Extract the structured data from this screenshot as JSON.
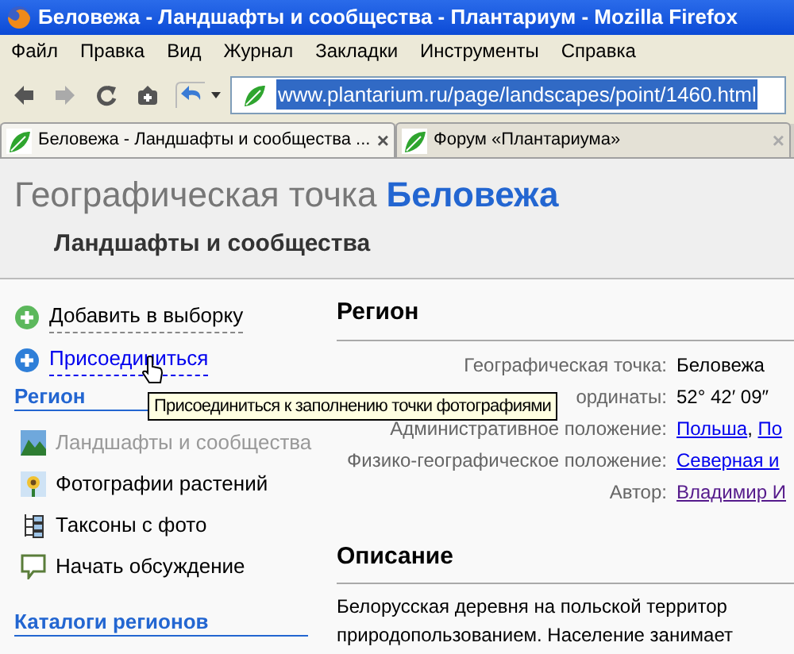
{
  "window": {
    "title": "Беловежа - Ландшафты и сообщества - Плантариум - Mozilla Firefox"
  },
  "menu": [
    "Файл",
    "Правка",
    "Вид",
    "Журнал",
    "Закладки",
    "Инструменты",
    "Справка"
  ],
  "address": {
    "value": "www.plantarium.ru/page/landscapes/point/1460.html",
    "selected": true
  },
  "tabs": [
    {
      "label": "Беловежа - Ландшафты и сообщества ...",
      "selected": true,
      "close": "×"
    },
    {
      "label": "Форум «Плантариума»",
      "selected": false,
      "close": "×"
    }
  ],
  "header": {
    "title": "Географическая точка",
    "name": "Беловежа",
    "subtitle": "Ландшафты и сообщества"
  },
  "actions": [
    {
      "label": "Добавить в выборку",
      "kind": "add"
    },
    {
      "label": "Присоединиться",
      "kind": "join"
    }
  ],
  "sidebar": {
    "title": "Регион",
    "items": [
      {
        "label": "Ландшафты и сообщества",
        "kind": "landscape",
        "disabled": true
      },
      {
        "label": "Фотографии растений",
        "kind": "photo",
        "disabled": false
      },
      {
        "label": "Таксоны с фото",
        "kind": "tree",
        "disabled": false
      },
      {
        "label": "Начать обсуждение",
        "kind": "chat",
        "disabled": false
      }
    ],
    "catalogs_title": "Каталоги регионов"
  },
  "region": {
    "title": "Регион",
    "rows": [
      {
        "label": "Географическая точка:",
        "values": [
          {
            "text": "Беловежа",
            "kind": "text"
          }
        ]
      },
      {
        "label": "ординаты:",
        "values": [
          {
            "text": "52° 42′ 09″",
            "kind": "text"
          }
        ]
      },
      {
        "label": "Административное положение:",
        "values": [
          {
            "text": "Польша",
            "kind": "link"
          },
          {
            "text": ", ",
            "kind": "text"
          },
          {
            "text": "По",
            "kind": "link"
          }
        ]
      },
      {
        "label": "Физико-географическое положение:",
        "values": [
          {
            "text": "Северная и",
            "kind": "link"
          }
        ]
      },
      {
        "label": "Автор:",
        "values": [
          {
            "text": "Владимир И",
            "kind": "visited"
          }
        ]
      }
    ]
  },
  "description": {
    "title": "Описание",
    "lines": [
      "Белорусская деревня на польской территор",
      "природопользованием. Население занимает"
    ]
  },
  "tooltip": "Присоединиться к заполнению точки фотографиями"
}
